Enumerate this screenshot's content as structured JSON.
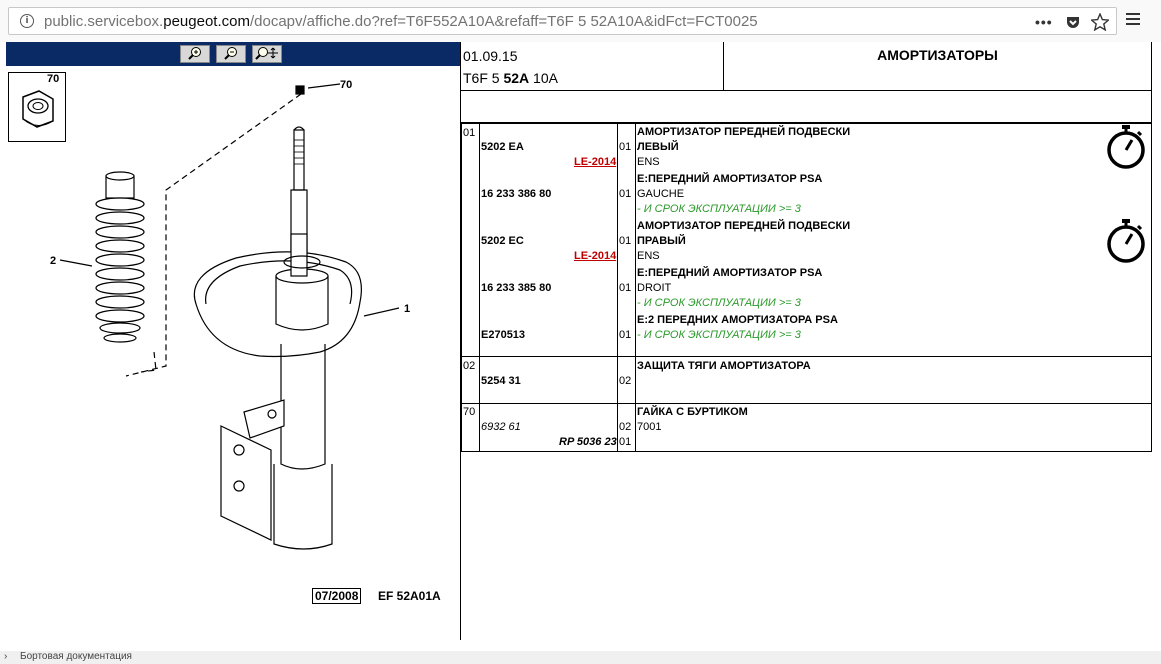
{
  "browser": {
    "url_prefix": "public.servicebox.",
    "url_domain": "peugeot.com",
    "url_suffix": "/docapv/affiche.do?ref=T6F552A10A&refaff=T6F 5 52A10A&idFct=FCT0025",
    "icons": [
      "info-icon",
      "more-icon",
      "pocket-icon",
      "bookmark-star-icon",
      "menu-icon"
    ]
  },
  "diagram": {
    "thumbnail_number": "70",
    "callouts": [
      "70",
      "2",
      "1"
    ],
    "footer_date": "07/2008",
    "footer_code": "EF 52A01A",
    "zoom_icons": [
      "zoom-in-icon",
      "zoom-out-icon",
      "zoom-pan-icon"
    ]
  },
  "header": {
    "date": "01.09.15",
    "code_a": "T6F 5 ",
    "code_b": "52A",
    "code_c": " 10A",
    "title": "АМОРТИЗАТОРЫ"
  },
  "parts": {
    "r1_pos": "01",
    "r1_ref1": "5202 EA",
    "r1_le1": "LE-2014",
    "r1_ref2": "16 233 386 80",
    "r1_ref3": "5202 EC",
    "r1_le2": "LE-2014",
    "r1_ref4": "16 233 385 80",
    "r1_ref5": "E270513",
    "r1_q1": "01",
    "r1_q2": "01",
    "r1_q3": "01",
    "r1_q4": "01",
    "r1_q5": "01",
    "r1_d1": "АМОРТИЗАТОР ПЕРЕДНЕЙ ПОДВЕСКИ",
    "r1_d2": "ЛЕВЫЙ",
    "r1_d3": "ENS",
    "r1_d4": "E:ПЕРЕДНИЙ АМОРТИЗАТОР PSA",
    "r1_d5": "GAUCHE",
    "r1_d6": "- И СРОК ЭКСПЛУАТАЦИИ >= 3",
    "r1_d7": "АМОРТИЗАТОР ПЕРЕДНЕЙ ПОДВЕСКИ",
    "r1_d8": "ПРАВЫЙ",
    "r1_d9": "ENS",
    "r1_d10": "E:ПЕРЕДНИЙ АМОРТИЗАТОР PSA",
    "r1_d11": "DROIT",
    "r1_d12": "- И СРОК ЭКСПЛУАТАЦИИ >= 3",
    "r1_d13": "E:2 ПЕРЕДНИХ АМОРТИЗАТОРА PSA",
    "r1_d14": "- И СРОК ЭКСПЛУАТАЦИИ >= 3",
    "r2_pos": "02",
    "r2_ref": "5254 31",
    "r2_q": "02",
    "r2_d": "ЗАЩИТА ТЯГИ АМОРТИЗАТОРА",
    "r3_pos": "70",
    "r3_ref1": "6932 61",
    "r3_ref2": "RP 5036 23",
    "r3_q1": "02",
    "r3_q2": "01",
    "r3_d1": "ГАЙКА С БУРТИКОМ",
    "r3_d2": "7001"
  },
  "status_bar": "Бортовая документация"
}
